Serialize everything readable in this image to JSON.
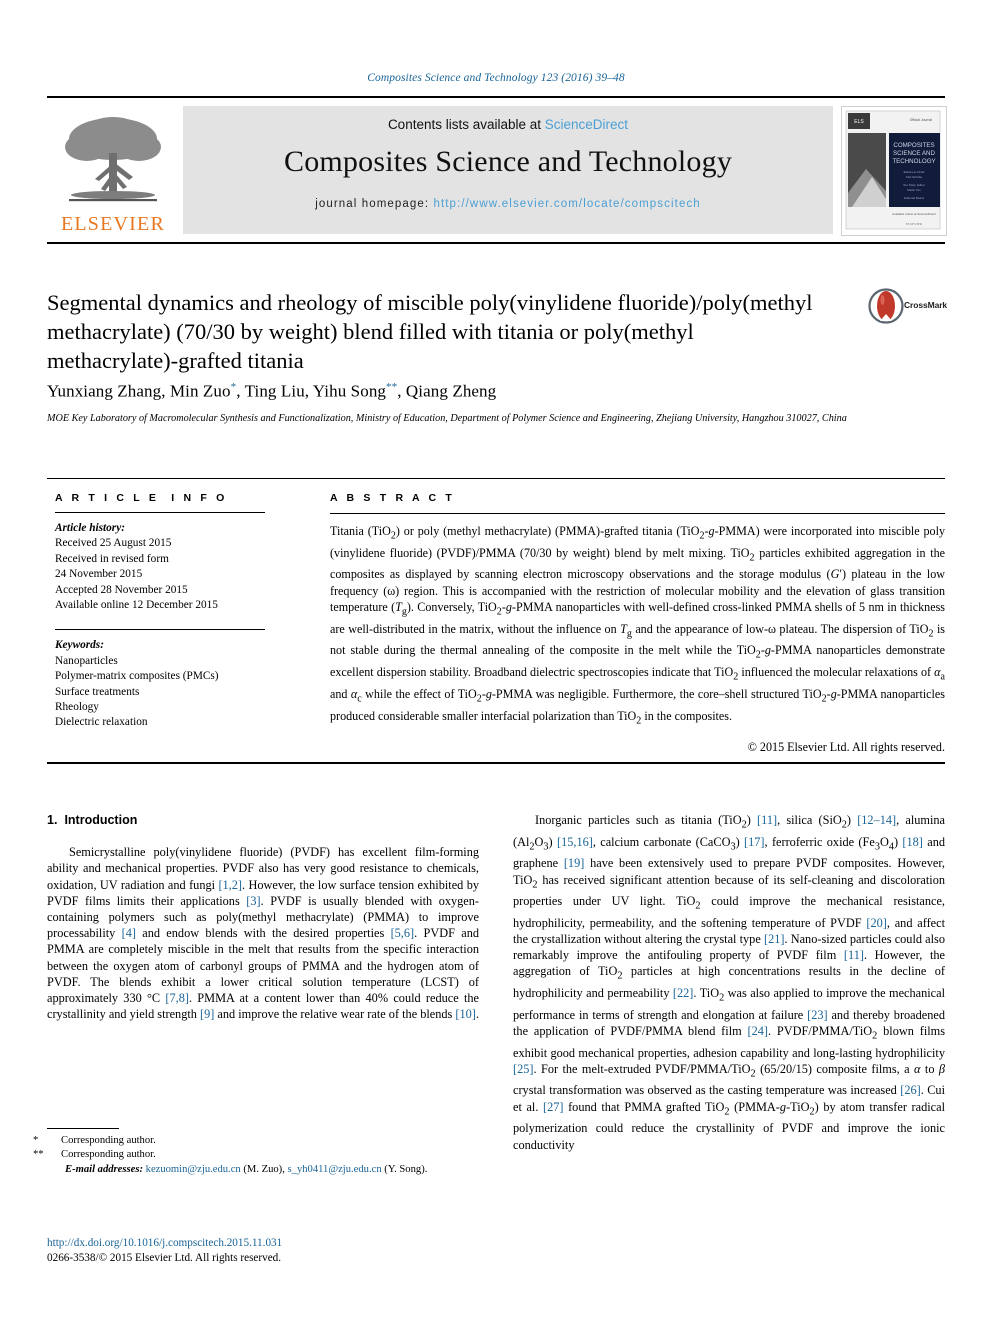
{
  "running_head": "Composites Science and Technology 123 (2016) 39–48",
  "masthead": {
    "contents_prefix": "Contents lists available at ",
    "contents_link": "ScienceDirect",
    "journal_title": "Composites Science and Technology",
    "homepage_prefix": "journal homepage: ",
    "homepage_url": "http://www.elsevier.com/locate/compscitech",
    "publisher": "ELSEVIER",
    "cover_title": "COMPOSITES SCIENCE AND TECHNOLOGY"
  },
  "article": {
    "title": "Segmental dynamics and rheology of miscible poly(vinylidene fluoride)/poly(methyl methacrylate) (70/30 by weight) blend filled with titania or poly(methyl methacrylate)-grafted titania",
    "crossmark_label": "CrossMark",
    "authors": "Yunxiang Zhang, Min Zuo*, Ting Liu, Yihu Song**, Qiang Zheng",
    "affiliation": "MOE Key Laboratory of Macromolecular Synthesis and Functionalization, Ministry of Education, Department of Polymer Science and Engineering, Zhejiang University, Hangzhou 310027, China"
  },
  "info": {
    "heading": "ARTICLE INFO",
    "history_label": "Article history:",
    "history": [
      "Received 25 August 2015",
      "Received in revised form",
      "24 November 2015",
      "Accepted 28 November 2015",
      "Available online 12 December 2015"
    ],
    "keywords_label": "Keywords:",
    "keywords": [
      "Nanoparticles",
      "Polymer-matrix composites (PMCs)",
      "Surface treatments",
      "Rheology",
      "Dielectric relaxation"
    ]
  },
  "abstract": {
    "heading": "ABSTRACT",
    "text": "Titania (TiO2) or poly (methyl methacrylate) (PMMA)-grafted titania (TiO2-g-PMMA) were incorporated into miscible poly (vinylidene fluoride) (PVDF)/PMMA (70/30 by weight) blend by melt mixing. TiO2 particles exhibited aggregation in the composites as displayed by scanning electron microscopy observations and the storage modulus (G') plateau in the low frequency (ω) region. This is accompanied with the restriction of molecular mobility and the elevation of glass transition temperature (Tg). Conversely, TiO2-g-PMMA nanoparticles with well-defined cross-linked PMMA shells of 5 nm in thickness are well-distributed in the matrix, without the influence on Tg and the appearance of low-ω plateau. The dispersion of TiO2 is not stable during the thermal annealing of the composite in the melt while the TiO2-g-PMMA nanoparticles demonstrate excellent dispersion stability. Broadband dielectric spectroscopies indicate that TiO2 influenced the molecular relaxations of αa and αc while the effect of TiO2-g-PMMA was negligible. Furthermore, the core–shell structured TiO2-g-PMMA nanoparticles produced considerable smaller interfacial polarization than TiO2 in the composites.",
    "copyright": "© 2015 Elsevier Ltd. All rights reserved."
  },
  "intro": {
    "number": "1.",
    "title": "Introduction",
    "left_paragraph": "Semicrystalline poly(vinylidene fluoride) (PVDF) has excellent film-forming ability and mechanical properties. PVDF also has very good resistance to chemicals, oxidation, UV radiation and fungi [1,2]. However, the low surface tension exhibited by PVDF films limits their applications [3]. PVDF is usually blended with oxygen-containing polymers such as poly(methyl methacrylate) (PMMA) to improve processability [4] and endow blends with the desired properties [5,6]. PVDF and PMMA are completely miscible in the melt that results from the specific interaction between the oxygen atom of carbonyl groups of PMMA and the hydrogen atom of PVDF. The blends exhibit a lower critical solution temperature (LCST) of approximately 330 °C [7,8]. PMMA at a content lower than 40% could reduce the crystallinity and yield strength [9] and improve the relative wear rate of the blends [10].",
    "right_paragraph": "Inorganic particles such as titania (TiO2) [11], silica (SiO2) [12–14], alumina (Al2O3) [15,16], calcium carbonate (CaCO3) [17], ferroferric oxide (Fe3O4) [18] and graphene [19] have been extensively used to prepare PVDF composites. However, TiO2 has received significant attention because of its self-cleaning and discoloration properties under UV light. TiO2 could improve the mechanical resistance, hydrophilicity, permeability, and the softening temperature of PVDF [20], and affect the crystallization without altering the crystal type [21]. Nano-sized particles could also remarkably improve the antifouling property of PVDF film [11]. However, the aggregation of TiO2 particles at high concentrations results in the decline of hydrophilicity and permeability [22]. TiO2 was also applied to improve the mechanical performance in terms of strength and elongation at failure [23] and thereby broadened the application of PVDF/PMMA blend film [24]. PVDF/PMMA/TiO2 blown films exhibit good mechanical properties, adhesion capability and long-lasting hydrophilicity [25]. For the melt-extruded PVDF/PMMA/TiO2 (65/20/15) composite films, a α to β crystal transformation was observed as the casting temperature was increased [26]. Cui et al. [27] found that PMMA grafted TiO2 (PMMA-g-TiO2) by atom transfer radical polymerization could reduce the crystallinity of PVDF and improve the ionic conductivity"
  },
  "footnotes": {
    "corr1_mark": "*",
    "corr1_text": "Corresponding author.",
    "corr2_mark": "**",
    "corr2_text": "Corresponding author.",
    "email_label": "E-mail addresses:",
    "email1": "kezuomin@zju.edu.cn",
    "email1_owner": "(M. Zuo),",
    "email2": "s_yh0411@zju.edu.cn",
    "email2_owner": "(Y. Song)."
  },
  "footer": {
    "doi": "http://dx.doi.org/10.1016/j.compscitech.2015.11.031",
    "issn_line": "0266-3538/© 2015 Elsevier Ltd. All rights reserved."
  },
  "colors": {
    "link": "#1a6496",
    "science_direct": "#4a9fd4",
    "elsevier_orange": "#E87722",
    "masthead_bg": "#e3e3e3"
  }
}
